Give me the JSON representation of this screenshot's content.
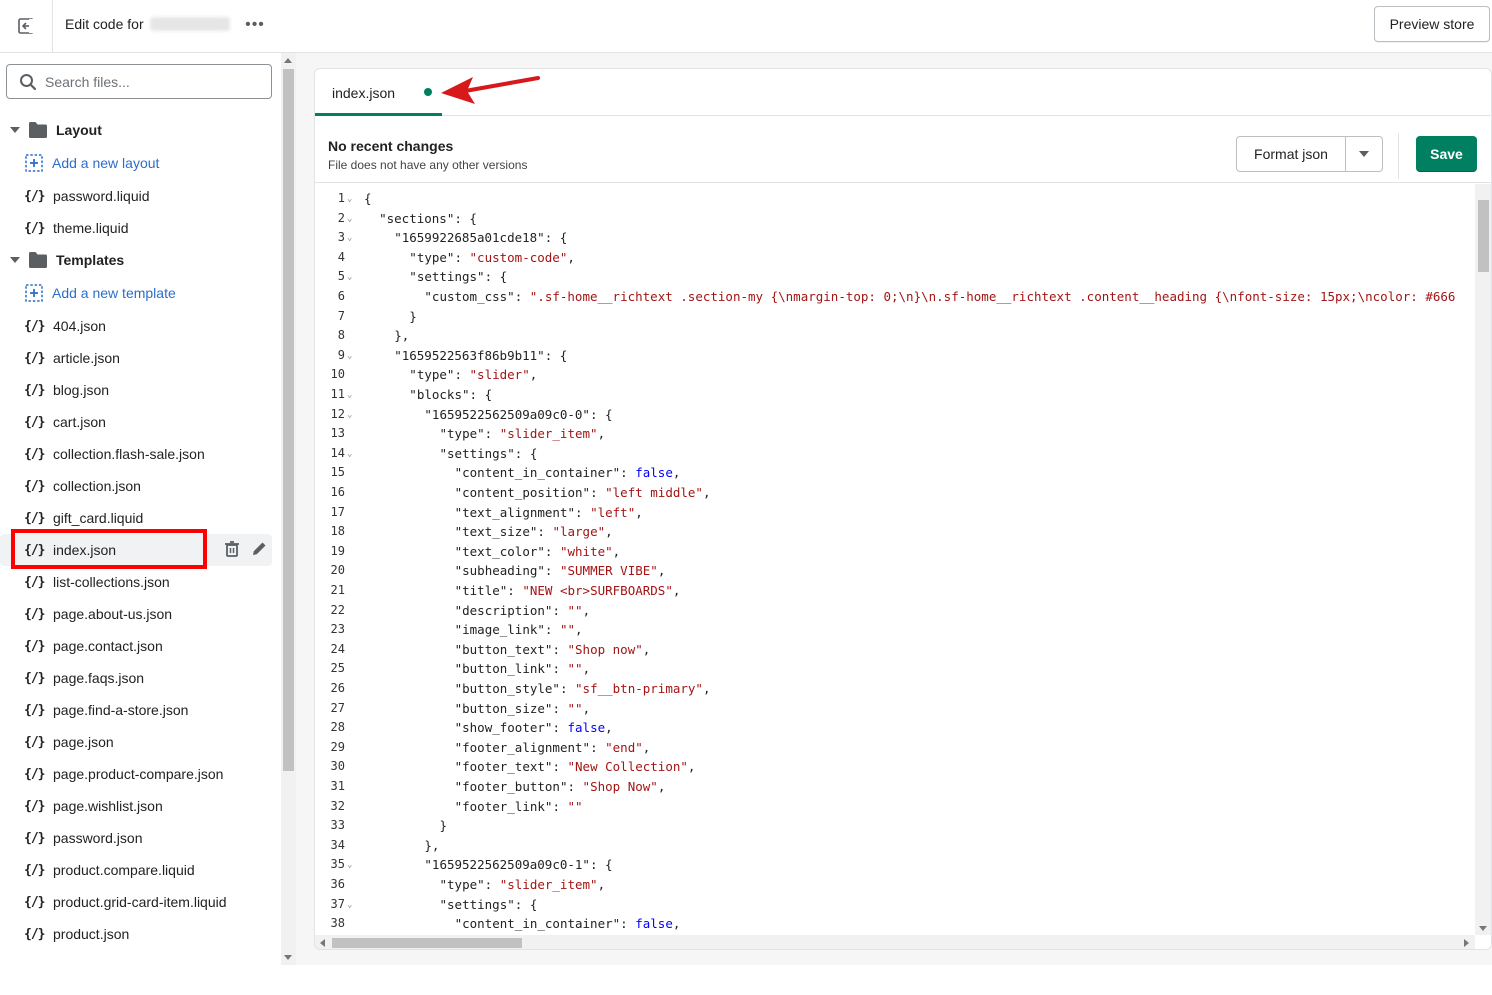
{
  "topbar": {
    "title": "Edit code for",
    "more_label": "•••",
    "preview_label": "Preview store"
  },
  "sidebar": {
    "search_placeholder": "Search files...",
    "layout": {
      "label": "Layout",
      "add_label": "Add a new layout",
      "files": [
        "password.liquid",
        "theme.liquid"
      ]
    },
    "templates": {
      "label": "Templates",
      "add_label": "Add a new template",
      "files": [
        "404.json",
        "article.json",
        "blog.json",
        "cart.json",
        "collection.flash-sale.json",
        "collection.json",
        "gift_card.liquid",
        "index.json",
        "list-collections.json",
        "page.about-us.json",
        "page.contact.json",
        "page.faqs.json",
        "page.find-a-store.json",
        "page.json",
        "page.product-compare.json",
        "page.wishlist.json",
        "password.json",
        "product.compare.liquid",
        "product.grid-card-item.liquid",
        "product.json"
      ],
      "active_file": "index.json"
    },
    "file_icon": "{/}"
  },
  "editor": {
    "tab_label": "index.json",
    "tab_unsaved": true,
    "status_title": "No recent changes",
    "status_subtitle": "File does not have any other versions",
    "format_label": "Format json",
    "save_label": "Save",
    "colors": {
      "accent": "#008060",
      "highlight": "#ff0000",
      "link": "#2c6ecb"
    },
    "code_lines": [
      {
        "n": "1",
        "fold": true,
        "indent": 0,
        "parts": [
          [
            "p",
            "{"
          ]
        ]
      },
      {
        "n": "2",
        "fold": true,
        "indent": 2,
        "parts": [
          [
            "k",
            "\"sections\""
          ],
          [
            "p",
            ": {"
          ]
        ]
      },
      {
        "n": "3",
        "fold": true,
        "indent": 4,
        "parts": [
          [
            "k",
            "\"1659922685a01cde18\""
          ],
          [
            "p",
            ": {"
          ]
        ]
      },
      {
        "n": "4",
        "fold": false,
        "indent": 6,
        "parts": [
          [
            "k",
            "\"type\""
          ],
          [
            "p",
            ": "
          ],
          [
            "s",
            "\"custom-code\""
          ],
          [
            "p",
            ","
          ]
        ]
      },
      {
        "n": "5",
        "fold": true,
        "indent": 6,
        "parts": [
          [
            "k",
            "\"settings\""
          ],
          [
            "p",
            ": {"
          ]
        ]
      },
      {
        "n": "6",
        "fold": false,
        "indent": 8,
        "parts": [
          [
            "k",
            "\"custom_css\""
          ],
          [
            "p",
            ": "
          ],
          [
            "s",
            "\".sf-home__richtext .section-my {\\nmargin-top: 0;\\n}\\n.sf-home__richtext .content__heading {\\nfont-size: 15px;\\ncolor: #666"
          ]
        ]
      },
      {
        "n": "7",
        "fold": false,
        "indent": 6,
        "parts": [
          [
            "p",
            "}"
          ]
        ]
      },
      {
        "n": "8",
        "fold": false,
        "indent": 4,
        "parts": [
          [
            "p",
            "},"
          ]
        ]
      },
      {
        "n": "9",
        "fold": true,
        "indent": 4,
        "parts": [
          [
            "k",
            "\"1659522563f86b9b11\""
          ],
          [
            "p",
            ": {"
          ]
        ]
      },
      {
        "n": "10",
        "fold": false,
        "indent": 6,
        "parts": [
          [
            "k",
            "\"type\""
          ],
          [
            "p",
            ": "
          ],
          [
            "s",
            "\"slider\""
          ],
          [
            "p",
            ","
          ]
        ]
      },
      {
        "n": "11",
        "fold": true,
        "indent": 6,
        "parts": [
          [
            "k",
            "\"blocks\""
          ],
          [
            "p",
            ": {"
          ]
        ]
      },
      {
        "n": "12",
        "fold": true,
        "indent": 8,
        "parts": [
          [
            "k",
            "\"1659522562509a09c0-0\""
          ],
          [
            "p",
            ": {"
          ]
        ]
      },
      {
        "n": "13",
        "fold": false,
        "indent": 10,
        "parts": [
          [
            "k",
            "\"type\""
          ],
          [
            "p",
            ": "
          ],
          [
            "s",
            "\"slider_item\""
          ],
          [
            "p",
            ","
          ]
        ]
      },
      {
        "n": "14",
        "fold": true,
        "indent": 10,
        "parts": [
          [
            "k",
            "\"settings\""
          ],
          [
            "p",
            ": {"
          ]
        ]
      },
      {
        "n": "15",
        "fold": false,
        "indent": 12,
        "parts": [
          [
            "k",
            "\"content_in_container\""
          ],
          [
            "p",
            ": "
          ],
          [
            "b",
            "false"
          ],
          [
            "p",
            ","
          ]
        ]
      },
      {
        "n": "16",
        "fold": false,
        "indent": 12,
        "parts": [
          [
            "k",
            "\"content_position\""
          ],
          [
            "p",
            ": "
          ],
          [
            "s",
            "\"left middle\""
          ],
          [
            "p",
            ","
          ]
        ]
      },
      {
        "n": "17",
        "fold": false,
        "indent": 12,
        "parts": [
          [
            "k",
            "\"text_alignment\""
          ],
          [
            "p",
            ": "
          ],
          [
            "s",
            "\"left\""
          ],
          [
            "p",
            ","
          ]
        ]
      },
      {
        "n": "18",
        "fold": false,
        "indent": 12,
        "parts": [
          [
            "k",
            "\"text_size\""
          ],
          [
            "p",
            ": "
          ],
          [
            "s",
            "\"large\""
          ],
          [
            "p",
            ","
          ]
        ]
      },
      {
        "n": "19",
        "fold": false,
        "indent": 12,
        "parts": [
          [
            "k",
            "\"text_color\""
          ],
          [
            "p",
            ": "
          ],
          [
            "s",
            "\"white\""
          ],
          [
            "p",
            ","
          ]
        ]
      },
      {
        "n": "20",
        "fold": false,
        "indent": 12,
        "parts": [
          [
            "k",
            "\"subheading\""
          ],
          [
            "p",
            ": "
          ],
          [
            "s",
            "\"SUMMER VIBE\""
          ],
          [
            "p",
            ","
          ]
        ]
      },
      {
        "n": "21",
        "fold": false,
        "indent": 12,
        "parts": [
          [
            "k",
            "\"title\""
          ],
          [
            "p",
            ": "
          ],
          [
            "s",
            "\"NEW <br>SURFBOARDS\""
          ],
          [
            "p",
            ","
          ]
        ]
      },
      {
        "n": "22",
        "fold": false,
        "indent": 12,
        "parts": [
          [
            "k",
            "\"description\""
          ],
          [
            "p",
            ": "
          ],
          [
            "s",
            "\"\""
          ],
          [
            "p",
            ","
          ]
        ]
      },
      {
        "n": "23",
        "fold": false,
        "indent": 12,
        "parts": [
          [
            "k",
            "\"image_link\""
          ],
          [
            "p",
            ": "
          ],
          [
            "s",
            "\"\""
          ],
          [
            "p",
            ","
          ]
        ]
      },
      {
        "n": "24",
        "fold": false,
        "indent": 12,
        "parts": [
          [
            "k",
            "\"button_text\""
          ],
          [
            "p",
            ": "
          ],
          [
            "s",
            "\"Shop now\""
          ],
          [
            "p",
            ","
          ]
        ]
      },
      {
        "n": "25",
        "fold": false,
        "indent": 12,
        "parts": [
          [
            "k",
            "\"button_link\""
          ],
          [
            "p",
            ": "
          ],
          [
            "s",
            "\"\""
          ],
          [
            "p",
            ","
          ]
        ]
      },
      {
        "n": "26",
        "fold": false,
        "indent": 12,
        "parts": [
          [
            "k",
            "\"button_style\""
          ],
          [
            "p",
            ": "
          ],
          [
            "s",
            "\"sf__btn-primary\""
          ],
          [
            "p",
            ","
          ]
        ]
      },
      {
        "n": "27",
        "fold": false,
        "indent": 12,
        "parts": [
          [
            "k",
            "\"button_size\""
          ],
          [
            "p",
            ": "
          ],
          [
            "s",
            "\"\""
          ],
          [
            "p",
            ","
          ]
        ]
      },
      {
        "n": "28",
        "fold": false,
        "indent": 12,
        "parts": [
          [
            "k",
            "\"show_footer\""
          ],
          [
            "p",
            ": "
          ],
          [
            "b",
            "false"
          ],
          [
            "p",
            ","
          ]
        ]
      },
      {
        "n": "29",
        "fold": false,
        "indent": 12,
        "parts": [
          [
            "k",
            "\"footer_alignment\""
          ],
          [
            "p",
            ": "
          ],
          [
            "s",
            "\"end\""
          ],
          [
            "p",
            ","
          ]
        ]
      },
      {
        "n": "30",
        "fold": false,
        "indent": 12,
        "parts": [
          [
            "k",
            "\"footer_text\""
          ],
          [
            "p",
            ": "
          ],
          [
            "s",
            "\"New Collection\""
          ],
          [
            "p",
            ","
          ]
        ]
      },
      {
        "n": "31",
        "fold": false,
        "indent": 12,
        "parts": [
          [
            "k",
            "\"footer_button\""
          ],
          [
            "p",
            ": "
          ],
          [
            "s",
            "\"Shop Now\""
          ],
          [
            "p",
            ","
          ]
        ]
      },
      {
        "n": "32",
        "fold": false,
        "indent": 12,
        "parts": [
          [
            "k",
            "\"footer_link\""
          ],
          [
            "p",
            ": "
          ],
          [
            "s",
            "\"\""
          ]
        ]
      },
      {
        "n": "33",
        "fold": false,
        "indent": 10,
        "parts": [
          [
            "p",
            "}"
          ]
        ]
      },
      {
        "n": "34",
        "fold": false,
        "indent": 8,
        "parts": [
          [
            "p",
            "},"
          ]
        ]
      },
      {
        "n": "35",
        "fold": true,
        "indent": 8,
        "parts": [
          [
            "k",
            "\"1659522562509a09c0-1\""
          ],
          [
            "p",
            ": {"
          ]
        ]
      },
      {
        "n": "36",
        "fold": false,
        "indent": 10,
        "parts": [
          [
            "k",
            "\"type\""
          ],
          [
            "p",
            ": "
          ],
          [
            "s",
            "\"slider_item\""
          ],
          [
            "p",
            ","
          ]
        ]
      },
      {
        "n": "37",
        "fold": true,
        "indent": 10,
        "parts": [
          [
            "k",
            "\"settings\""
          ],
          [
            "p",
            ": {"
          ]
        ]
      },
      {
        "n": "38",
        "fold": false,
        "indent": 12,
        "parts": [
          [
            "k",
            "\"content_in_container\""
          ],
          [
            "p",
            ": "
          ],
          [
            "b",
            "false"
          ],
          [
            "p",
            ","
          ]
        ]
      }
    ]
  }
}
